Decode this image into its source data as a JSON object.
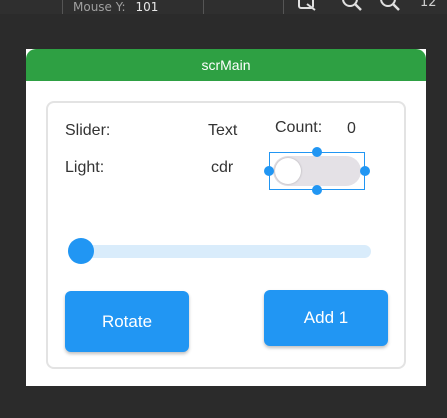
{
  "toolbar": {
    "mouse_y_label": "Mouse Y:",
    "mouse_y_value": "101",
    "zoom_readout": "12"
  },
  "screen": {
    "title": "scrMain",
    "title_bar_color": "#2ea043"
  },
  "labels": {
    "slider_label": "Slider:",
    "slider_value": "Text",
    "count_label": "Count:",
    "count_value": "0",
    "light_label": "Light:",
    "light_value": "cdr"
  },
  "switch": {
    "state": "off"
  },
  "slider": {
    "value_fraction": 0.0
  },
  "buttons": {
    "rotate_label": "Rotate",
    "add_label": "Add 1"
  },
  "colors": {
    "accent": "#2196f3"
  },
  "icons": [
    "crop-icon",
    "zoom-out-icon",
    "zoom-in-icon"
  ]
}
